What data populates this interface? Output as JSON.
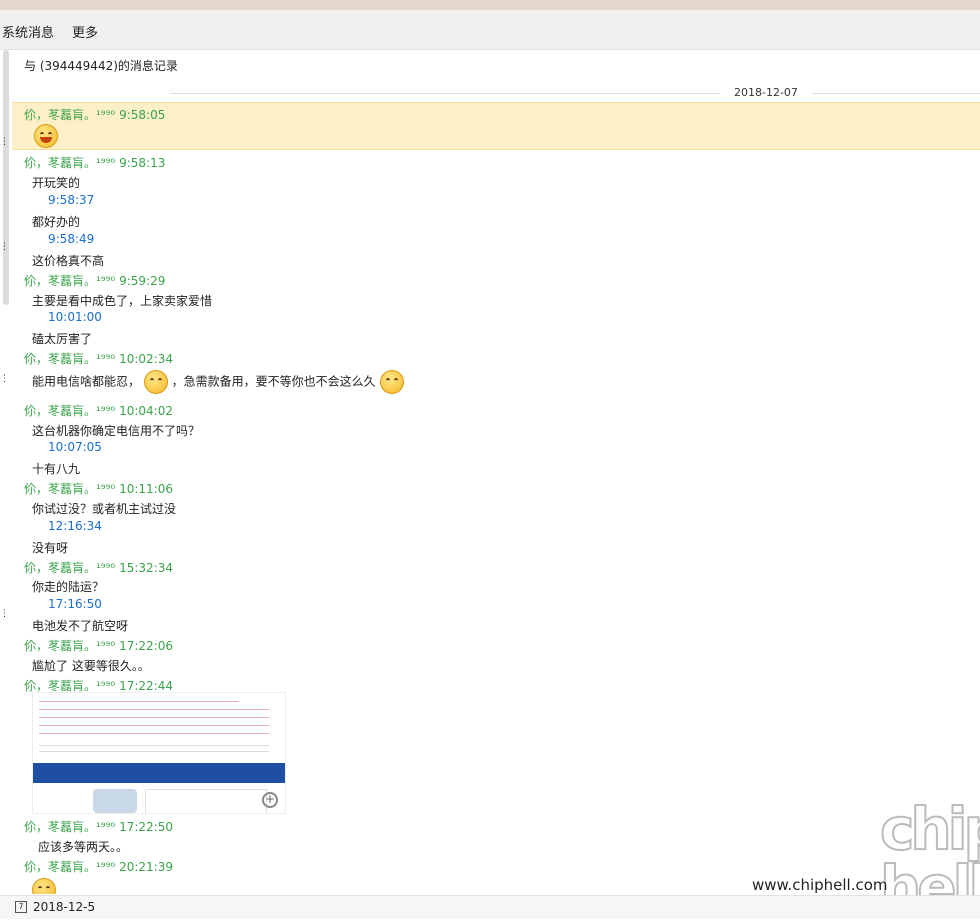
{
  "menu": {
    "items": [
      "系统消息",
      "更多"
    ]
  },
  "header": {
    "title": "与      (394449442)的消息记录"
  },
  "divider_date": "2018-12-07",
  "messages": [
    {
      "sender": "伱，苳藞肓。¹⁹⁹⁰",
      "time": "9:58:05"
    },
    {
      "sender": "伱，苳藞肓。¹⁹⁹⁰",
      "time": "9:58:13"
    },
    {
      "text": "开玩笑的"
    },
    {
      "time": "9:58:37"
    },
    {
      "text": "都好办的"
    },
    {
      "time": "9:58:49"
    },
    {
      "text": "这价格真不高"
    },
    {
      "sender": "伱，苳藞肓。¹⁹⁹⁰",
      "time": "9:59:29"
    },
    {
      "text": "主要是看中成色了，上家卖家爱惜"
    },
    {
      "time": "10:01:00"
    },
    {
      "text": "磕太厉害了"
    },
    {
      "sender": "伱，苳藞肓。¹⁹⁹⁰",
      "time": "10:02:34"
    },
    {
      "text_a": "能用电信啥都能忍，",
      "text_b": "，急需款备用，要不等你也不会这么久"
    },
    {
      "sender": "伱，苳藞肓。¹⁹⁹⁰",
      "time": "10:04:02"
    },
    {
      "text": "这台机器你确定电信用不了吗？"
    },
    {
      "time": "10:07:05"
    },
    {
      "text": "十有八九"
    },
    {
      "sender": "伱，苳藞肓。¹⁹⁹⁰",
      "time": "10:11:06"
    },
    {
      "text": "你试过没？或者机主试过没"
    },
    {
      "time": "12:16:34"
    },
    {
      "text": "没有呀"
    },
    {
      "sender": "伱，苳藞肓。¹⁹⁹⁰",
      "time": "15:32:34"
    },
    {
      "text": "你走的陆运？"
    },
    {
      "time": "17:16:50"
    },
    {
      "text": "电池发不了航空呀"
    },
    {
      "sender": "伱，苳藞肓。¹⁹⁹⁰",
      "time": "17:22:06"
    },
    {
      "text": "尴尬了 这要等很久。。"
    },
    {
      "sender": "伱，苳藞肓。¹⁹⁹⁰",
      "time": "17:22:44"
    },
    {
      "sender": "伱，苳藞肓。¹⁹⁹⁰",
      "time": "17:22:50"
    },
    {
      "text": "应该多等两天。。"
    },
    {
      "sender": "伱，苳藞肓。¹⁹⁹⁰",
      "time": "20:21:39"
    }
  ],
  "watermark": {
    "url": "www.chiphell.com",
    "logo": "chip hell"
  },
  "footer": {
    "date": "2018-12-5"
  },
  "colors": {
    "sender": "#3aa34a",
    "time": "#1a6fd0",
    "highlight": "#fdf0c8"
  }
}
